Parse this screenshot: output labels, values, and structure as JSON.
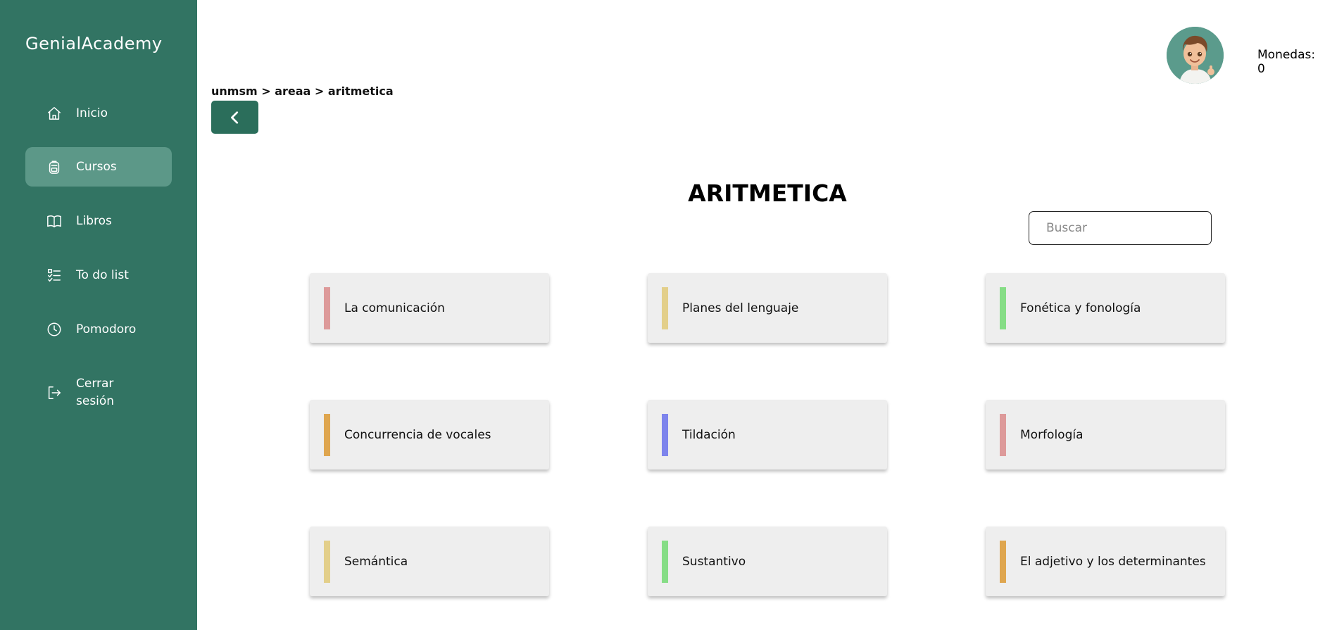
{
  "sidebar": {
    "brand": "GenialAcademy",
    "items": [
      {
        "label": "Inicio",
        "icon": "home-icon"
      },
      {
        "label": "Cursos",
        "icon": "backpack-icon",
        "active": true
      },
      {
        "label": "Libros",
        "icon": "book-icon"
      },
      {
        "label": "To do list",
        "icon": "checklist-icon"
      },
      {
        "label": "Pomodoro",
        "icon": "clock-icon"
      },
      {
        "label": "Cerrar sesión",
        "icon": "logout-icon"
      }
    ]
  },
  "header": {
    "breadcrumb": "unmsm > areaa > aritmetica",
    "coins_label": "Monedas: 0"
  },
  "main": {
    "title": "ARITMETICA",
    "search": {
      "placeholder": "Buscar"
    },
    "courses": [
      {
        "label": "La comunicación",
        "color": "#dd9a9a"
      },
      {
        "label": "Planes del lenguaje",
        "color": "#e3cf8a"
      },
      {
        "label": "Fonética y fonología",
        "color": "#86dd86"
      },
      {
        "label": "Concurrencia de vocales",
        "color": "#dfa64f"
      },
      {
        "label": "Tildación",
        "color": "#7d84ec"
      },
      {
        "label": "Morfología",
        "color": "#dd9a9a"
      },
      {
        "label": "Semántica",
        "color": "#e3cf8a"
      },
      {
        "label": "Sustantivo",
        "color": "#86dd86"
      },
      {
        "label": "El adjetivo y los determinantes",
        "color": "#dfa64f"
      }
    ]
  },
  "colors": {
    "sidebar": "#327463",
    "sidebar_active": "#5c9888",
    "back_button": "#2b6e5b"
  }
}
